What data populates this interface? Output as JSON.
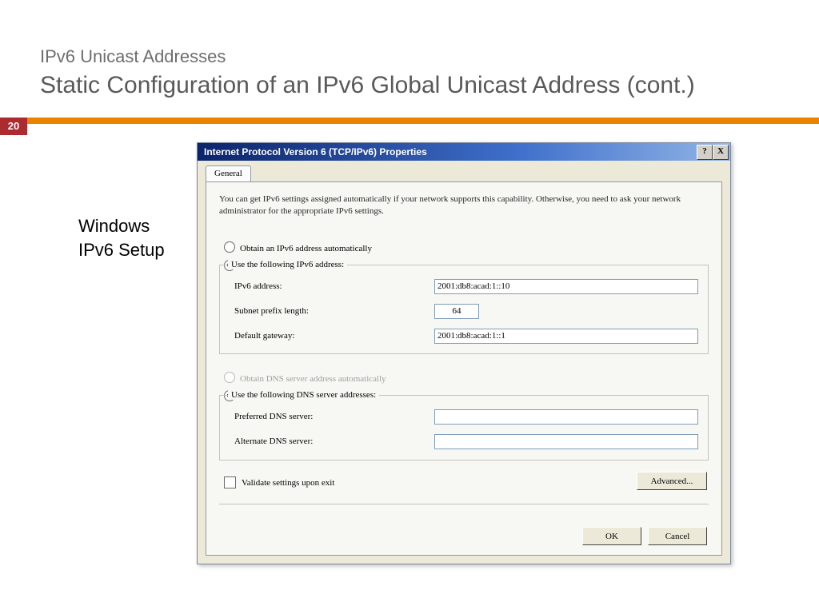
{
  "slide": {
    "pretitle": "IPv6 Unicast Addresses",
    "title": "Static Configuration of an IPv6 Global Unicast Address (cont.)",
    "number": "20",
    "caption_line1": "Windows",
    "caption_line2": "IPv6 Setup"
  },
  "window": {
    "title": "Internet Protocol Version 6 (TCP/IPv6) Properties",
    "help_btn": "?",
    "close_btn": "X",
    "tab": "General",
    "description": "You can get IPv6 settings assigned automatically if your network supports this capability. Otherwise, you need to ask your network administrator for the appropriate IPv6 settings.",
    "radio_auto_addr": "Obtain an IPv6 address automatically",
    "radio_manual_addr": "Use the following IPv6 address:",
    "fields": {
      "ipv6_label": "IPv6 address:",
      "ipv6_value": "2001:db8:acad:1::10",
      "prefix_label": "Subnet prefix length:",
      "prefix_value": "64",
      "gateway_label": "Default gateway:",
      "gateway_value": "2001:db8:acad:1::1"
    },
    "radio_auto_dns": "Obtain DNS server address automatically",
    "radio_manual_dns": "Use the following DNS server addresses:",
    "dns": {
      "pref_label": "Preferred DNS server:",
      "pref_value": "",
      "alt_label": "Alternate DNS server:",
      "alt_value": ""
    },
    "validate": "Validate settings upon exit",
    "advanced": "Advanced...",
    "ok": "OK",
    "cancel": "Cancel"
  }
}
